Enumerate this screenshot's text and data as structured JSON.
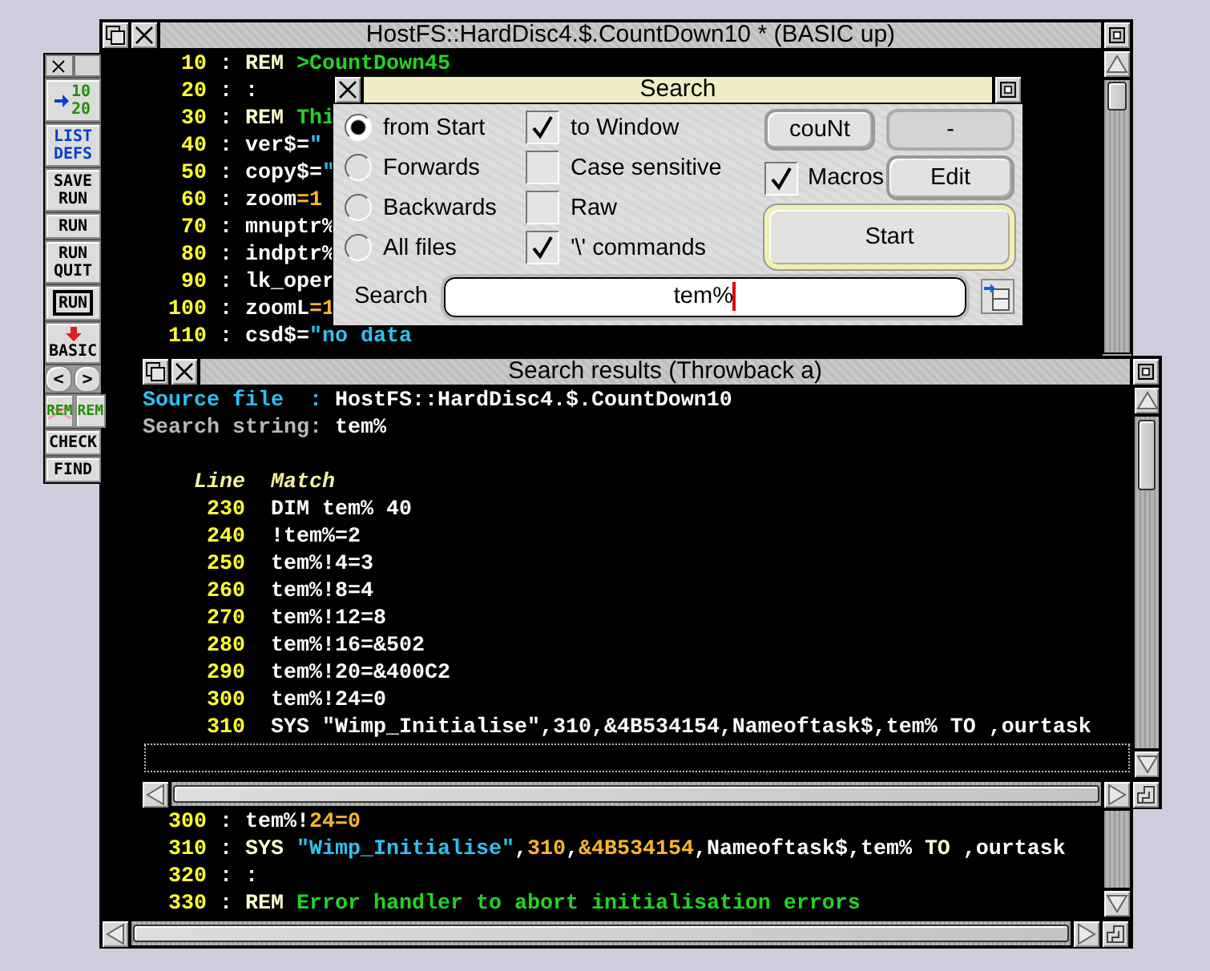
{
  "editor": {
    "title": "HostFS::HardDisc4.$.CountDown10 * (BASIC up)",
    "lines_top": [
      {
        "number": "10",
        "segments": [
          {
            "kind": "plain",
            "text": " : "
          },
          {
            "kind": "keyword",
            "text": "REM "
          },
          {
            "kind": "comment",
            "text": ">CountDown45"
          }
        ]
      },
      {
        "number": "20",
        "segments": [
          {
            "kind": "plain",
            "text": " : :"
          }
        ]
      },
      {
        "number": "30",
        "segments": [
          {
            "kind": "plain",
            "text": " : "
          },
          {
            "kind": "keyword",
            "text": "REM "
          },
          {
            "kind": "comment",
            "text": "Thi"
          }
        ]
      },
      {
        "number": "40",
        "segments": [
          {
            "kind": "plain",
            "text": " : ver$="
          },
          {
            "kind": "string",
            "text": "\""
          }
        ]
      },
      {
        "number": "50",
        "segments": [
          {
            "kind": "plain",
            "text": " : copy$="
          },
          {
            "kind": "string",
            "text": "\""
          }
        ]
      },
      {
        "number": "60",
        "segments": [
          {
            "kind": "plain",
            "text": " : zoom"
          },
          {
            "kind": "number",
            "text": "=1"
          }
        ]
      },
      {
        "number": "70",
        "segments": [
          {
            "kind": "plain",
            "text": " : mnuptr%"
          }
        ]
      },
      {
        "number": "80",
        "segments": [
          {
            "kind": "plain",
            "text": " : indptr%"
          }
        ]
      },
      {
        "number": "90",
        "segments": [
          {
            "kind": "plain",
            "text": " : lk_oper"
          }
        ]
      },
      {
        "number": "100",
        "segments": [
          {
            "kind": "plain",
            "text": " : zoomL"
          },
          {
            "kind": "number",
            "text": "=1"
          }
        ]
      },
      {
        "number": "110",
        "segments": [
          {
            "kind": "plain",
            "text": " : csd$="
          },
          {
            "kind": "string",
            "text": "\"no data"
          }
        ]
      }
    ],
    "lines_bottom": [
      {
        "number": "300",
        "segments": [
          {
            "kind": "plain",
            "text": " : tem%!"
          },
          {
            "kind": "number",
            "text": "24=0"
          }
        ]
      },
      {
        "number": "310",
        "segments": [
          {
            "kind": "plain",
            "text": " : "
          },
          {
            "kind": "keyword",
            "text": "SYS "
          },
          {
            "kind": "string",
            "text": "\"Wimp_Initialise\""
          },
          {
            "kind": "plain",
            "text": ","
          },
          {
            "kind": "number",
            "text": "310"
          },
          {
            "kind": "plain",
            "text": ","
          },
          {
            "kind": "number",
            "text": "&4B534154"
          },
          {
            "kind": "plain",
            "text": ",Nameoftask$,tem% "
          },
          {
            "kind": "keyword",
            "text": "TO"
          },
          {
            "kind": "plain",
            "text": " ,ourtask"
          }
        ]
      },
      {
        "number": "320",
        "segments": [
          {
            "kind": "plain",
            "text": " : :"
          }
        ]
      },
      {
        "number": "330",
        "segments": [
          {
            "kind": "plain",
            "text": " : "
          },
          {
            "kind": "keyword",
            "text": "REM "
          },
          {
            "kind": "comment",
            "text": "Error handler to abort initialisation errors"
          }
        ]
      }
    ]
  },
  "toolbar": [
    {
      "kind": "renumber",
      "lines": [
        "10",
        "20"
      ]
    },
    {
      "kind": "blue",
      "lines": [
        "LIST",
        "DEFS"
      ]
    },
    {
      "kind": "plain",
      "lines": [
        "SAVE",
        "RUN"
      ]
    },
    {
      "kind": "plain",
      "lines": [
        "RUN"
      ]
    },
    {
      "kind": "plain",
      "lines": [
        "RUN",
        "QUIT"
      ]
    },
    {
      "kind": "framed",
      "lines": [
        "RUN"
      ]
    },
    {
      "kind": "basic",
      "lines": [
        "BASIC"
      ]
    },
    {
      "kind": "pair",
      "lines": [
        "<",
        ">"
      ]
    },
    {
      "kind": "rem",
      "lines": [
        "REM",
        "REM"
      ]
    },
    {
      "kind": "plain",
      "lines": [
        "CHECK"
      ]
    },
    {
      "kind": "plain",
      "lines": [
        "FIND"
      ]
    }
  ],
  "search_dialog": {
    "title": "Search",
    "directions": [
      {
        "label": "from Start",
        "selected": true
      },
      {
        "label": "Forwards",
        "selected": false
      },
      {
        "label": "Backwards",
        "selected": false
      },
      {
        "label": "All files",
        "selected": false
      }
    ],
    "options": [
      {
        "label": "to Window",
        "checked": true
      },
      {
        "label": "Case sensitive",
        "checked": false
      },
      {
        "label": "Raw",
        "checked": false
      },
      {
        "label": "'\\' commands",
        "checked": true
      }
    ],
    "count_button": "couNt",
    "count_display": "-",
    "macros": {
      "label": "Macros",
      "checked": true
    },
    "edit_button": "Edit",
    "start_button": "Start",
    "search": {
      "label": "Search",
      "value": "tem%"
    }
  },
  "search_results": {
    "title": "Search results (Throwback a)",
    "source_label": "Source file  :",
    "source_value": "HostFS::HardDisc4.$.CountDown10",
    "string_label": "Search string:",
    "string_value": "tem%",
    "columns": [
      "Line",
      "Match"
    ],
    "rows": [
      {
        "line": "230",
        "match": "DIM tem% 40"
      },
      {
        "line": "240",
        "match": "!tem%=2"
      },
      {
        "line": "250",
        "match": "tem%!4=3"
      },
      {
        "line": "260",
        "match": "tem%!8=4"
      },
      {
        "line": "270",
        "match": "tem%!12=8"
      },
      {
        "line": "280",
        "match": "tem%!16=&502"
      },
      {
        "line": "290",
        "match": "tem%!20=&400C2"
      },
      {
        "line": "300",
        "match": "tem%!24=0"
      },
      {
        "line": "310",
        "match": "SYS \"Wimp_Initialise\",310,&4B534154,Nameoftask$,tem% TO ,ourtask"
      }
    ]
  }
}
